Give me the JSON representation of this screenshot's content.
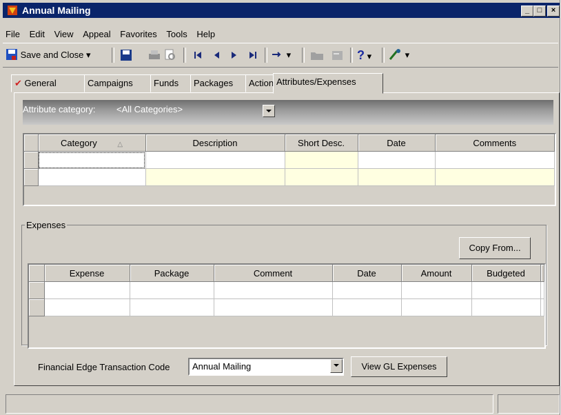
{
  "window": {
    "title": "Annual Mailing",
    "min_btn": "_",
    "max_btn": "□",
    "close_btn": "×"
  },
  "menu": [
    "File",
    "Edit",
    "View",
    "Appeal",
    "Favorites",
    "Tools",
    "Help"
  ],
  "toolbar": {
    "save_close": "Save and Close",
    "dropdown_glyph": "▾",
    "help_glyph": "?"
  },
  "tabs": [
    "General",
    "Campaigns",
    "Funds",
    "Packages",
    "Actions",
    "Attributes/Expenses"
  ],
  "tab_checkmark": "✔",
  "attributes": {
    "category_label": "Attribute category:",
    "category_value": "<All Categories>",
    "columns": [
      "Category",
      "Description",
      "Short Desc.",
      "Date",
      "Comments"
    ],
    "sort_glyph": "△"
  },
  "expenses": {
    "legend": "Expenses",
    "copy_from": "Copy From...",
    "columns": [
      "Expense",
      "Package",
      "Comment",
      "Date",
      "Amount",
      "Budgeted"
    ]
  },
  "footer": {
    "fe_label": "Financial Edge Transaction Code",
    "fe_value": "Annual Mailing",
    "view_gl": "View GL Expenses"
  },
  "colors": {
    "titlebar": "#0a246a",
    "face": "#d4d0c8",
    "required_cell": "#ffffe1"
  }
}
